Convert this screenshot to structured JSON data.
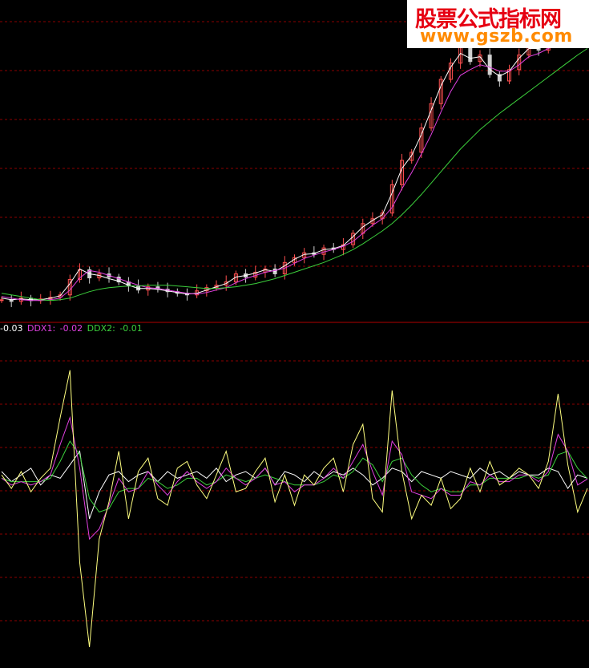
{
  "watermark": {
    "title": "股票公式指标网",
    "url": "www.gszb.com"
  },
  "indicator_legend": {
    "ddx_value": "-0.03",
    "ddx1_label": "DDX1:",
    "ddx1_value": "-0.02",
    "ddx2_label": "DDX2:",
    "ddx2_value": "-0.01"
  },
  "colors": {
    "background": "#000000",
    "grid": "#8b0000",
    "divider": "#b00000",
    "candle_up": "#ff5050",
    "ma_white": "#ffffff",
    "ma_magenta": "#e040e0",
    "ma_green": "#3cd03c",
    "ddx": "#ffff80",
    "ddx_white": "#ffffff",
    "ddx1": "#e040e0",
    "ddx2": "#3cd03c"
  },
  "chart_data": [
    {
      "type": "line",
      "panel": "price",
      "x": [
        0,
        2,
        4,
        6,
        8,
        10,
        12,
        14,
        16,
        18,
        20,
        22,
        24,
        26,
        28,
        30,
        32,
        34,
        36,
        38,
        40,
        42,
        44,
        46,
        48,
        50,
        52,
        54,
        56,
        58,
        60,
        62,
        64,
        66,
        68,
        70,
        72,
        74,
        76,
        78,
        80,
        82,
        84,
        86,
        88,
        90,
        92,
        94,
        96,
        98,
        100,
        102,
        104,
        106,
        108,
        110,
        112,
        114,
        116,
        118,
        120
      ],
      "series": [
        {
          "key": "close",
          "values": [
            58,
            56,
            60,
            57,
            59,
            61,
            64,
            83,
            95,
            85,
            90,
            86,
            80,
            75,
            70,
            74,
            71,
            68,
            66,
            64,
            69,
            73,
            76,
            80,
            90,
            86,
            92,
            96,
            90,
            104,
            110,
            116,
            114,
            122,
            120,
            126,
            140,
            152,
            158,
            165,
            200,
            230,
            240,
            270,
            300,
            330,
            350,
            370,
            352,
            360,
            336,
            328,
            342,
            360,
            372,
            366,
            378,
            384,
            390,
            402,
            410
          ]
        },
        {
          "key": "ma_fast",
          "values": [
            60,
            58,
            59,
            58,
            58,
            60,
            63,
            78,
            96,
            90,
            88,
            84,
            81,
            76,
            72,
            72,
            71,
            69,
            67,
            65,
            66,
            70,
            74,
            78,
            86,
            88,
            91,
            95,
            93,
            100,
            108,
            114,
            115,
            120,
            121,
            125,
            136,
            148,
            156,
            163,
            190,
            220,
            236,
            262,
            292,
            322,
            345,
            362,
            356,
            358,
            342,
            334,
            340,
            356,
            368,
            368,
            376,
            382,
            388,
            398,
            405
          ]
        },
        {
          "key": "ma_mid",
          "values": [
            62,
            60,
            58,
            57,
            57,
            58,
            60,
            70,
            85,
            94,
            92,
            88,
            84,
            80,
            76,
            73,
            72,
            70,
            68,
            66,
            65,
            67,
            70,
            73,
            79,
            84,
            88,
            92,
            94,
            97,
            103,
            109,
            113,
            117,
            120,
            124,
            130,
            140,
            150,
            158,
            172,
            195,
            215,
            238,
            262,
            290,
            315,
            335,
            342,
            348,
            345,
            340,
            340,
            348,
            358,
            362,
            368,
            374,
            380,
            388,
            395
          ]
        },
        {
          "key": "ma_slow",
          "values": [
            66,
            64,
            62,
            60,
            58,
            57,
            58,
            60,
            64,
            68,
            71,
            73,
            74,
            75,
            75,
            76,
            76,
            76,
            75,
            74,
            73,
            72,
            72,
            73,
            74,
            76,
            78,
            81,
            84,
            88,
            92,
            96,
            100,
            104,
            109,
            114,
            120,
            127,
            135,
            143,
            152,
            163,
            175,
            188,
            202,
            216,
            230,
            244,
            256,
            268,
            278,
            288,
            297,
            306,
            315,
            324,
            333,
            342,
            351,
            360,
            368
          ]
        }
      ],
      "ylim": [
        40,
        420
      ]
    },
    {
      "type": "line",
      "panel": "indicator",
      "x": [
        0,
        2,
        4,
        6,
        8,
        10,
        12,
        14,
        16,
        18,
        20,
        22,
        24,
        26,
        28,
        30,
        32,
        34,
        36,
        38,
        40,
        42,
        44,
        46,
        48,
        50,
        52,
        54,
        56,
        58,
        60,
        62,
        64,
        66,
        68,
        70,
        72,
        74,
        76,
        78,
        80,
        82,
        84,
        86,
        88,
        90,
        92,
        94,
        96,
        98,
        100,
        102,
        104,
        106,
        108,
        110,
        112,
        114,
        116,
        118,
        120
      ],
      "series": [
        {
          "name": "DDX",
          "key": "ddx",
          "values": [
            0.1,
            -0.3,
            0.2,
            -0.4,
            0.0,
            0.3,
            1.8,
            3.2,
            -2.5,
            -5.0,
            -1.8,
            -0.7,
            0.8,
            -1.2,
            0.2,
            0.6,
            -0.6,
            -0.8,
            0.3,
            0.5,
            -0.2,
            -0.6,
            0.1,
            0.8,
            -0.4,
            -0.3,
            0.2,
            0.6,
            -0.7,
            0.1,
            -0.8,
            0.1,
            -0.2,
            0.3,
            0.6,
            -0.4,
            1.0,
            1.6,
            -0.6,
            -1.0,
            2.6,
            0.2,
            -1.2,
            -0.5,
            -0.8,
            0.0,
            -0.9,
            -0.6,
            0.3,
            -0.4,
            0.5,
            -0.2,
            0.0,
            0.3,
            0.1,
            -0.3,
            0.5,
            2.5,
            0.4,
            -1.0,
            -0.3
          ]
        },
        {
          "name": "DDX1",
          "key": "ddx1",
          "values": [
            0.0,
            -0.2,
            -0.1,
            -0.2,
            -0.1,
            0.1,
            1.0,
            1.8,
            0.3,
            -1.8,
            -1.5,
            -0.8,
            0.0,
            -0.4,
            -0.3,
            0.2,
            -0.2,
            -0.5,
            -0.1,
            0.2,
            -0.1,
            -0.3,
            -0.1,
            0.3,
            0.0,
            -0.2,
            0.0,
            0.3,
            -0.2,
            -0.1,
            -0.4,
            -0.2,
            -0.2,
            0.0,
            0.3,
            0.0,
            0.5,
            1.0,
            0.2,
            -0.5,
            1.1,
            0.7,
            -0.4,
            -0.5,
            -0.6,
            -0.3,
            -0.5,
            -0.5,
            -0.1,
            -0.2,
            0.1,
            -0.1,
            -0.1,
            0.1,
            0.1,
            -0.1,
            0.2,
            1.3,
            0.8,
            -0.2,
            -0.02
          ]
        },
        {
          "name": "DDX2",
          "key": "ddx2",
          "values": [
            0.0,
            -0.1,
            -0.1,
            -0.1,
            -0.1,
            0.0,
            0.5,
            1.1,
            0.7,
            -0.6,
            -1.0,
            -0.9,
            -0.4,
            -0.3,
            -0.3,
            0.0,
            -0.1,
            -0.3,
            -0.2,
            0.0,
            0.0,
            -0.2,
            -0.1,
            0.1,
            0.0,
            -0.1,
            0.0,
            0.1,
            0.0,
            -0.1,
            -0.2,
            -0.2,
            -0.2,
            -0.1,
            0.1,
            0.0,
            0.2,
            0.6,
            0.4,
            -0.1,
            0.5,
            0.6,
            0.1,
            -0.2,
            -0.4,
            -0.3,
            -0.4,
            -0.4,
            -0.2,
            -0.2,
            0.0,
            0.0,
            0.0,
            0.0,
            0.1,
            0.0,
            0.1,
            0.7,
            0.8,
            0.3,
            -0.01
          ]
        },
        {
          "key": "ddx_white",
          "values": [
            0.2,
            -0.1,
            0.1,
            0.3,
            -0.2,
            0.1,
            0.0,
            0.4,
            0.8,
            -1.2,
            -0.4,
            0.1,
            0.2,
            -0.1,
            0.1,
            0.2,
            -0.1,
            0.2,
            0.0,
            0.1,
            0.2,
            0.0,
            0.3,
            -0.1,
            0.1,
            0.2,
            0.0,
            0.3,
            -0.2,
            0.2,
            0.1,
            -0.1,
            0.2,
            0.0,
            0.2,
            0.1,
            0.3,
            0.1,
            -0.2,
            0.0,
            0.3,
            0.2,
            -0.1,
            0.2,
            0.1,
            0.0,
            0.2,
            0.1,
            0.0,
            0.3,
            0.1,
            0.2,
            0.0,
            0.2,
            0.1,
            0.1,
            0.3,
            0.2,
            -0.3,
            0.1,
            0.0
          ]
        }
      ],
      "ylim": [
        -5.5,
        4.0
      ]
    }
  ]
}
